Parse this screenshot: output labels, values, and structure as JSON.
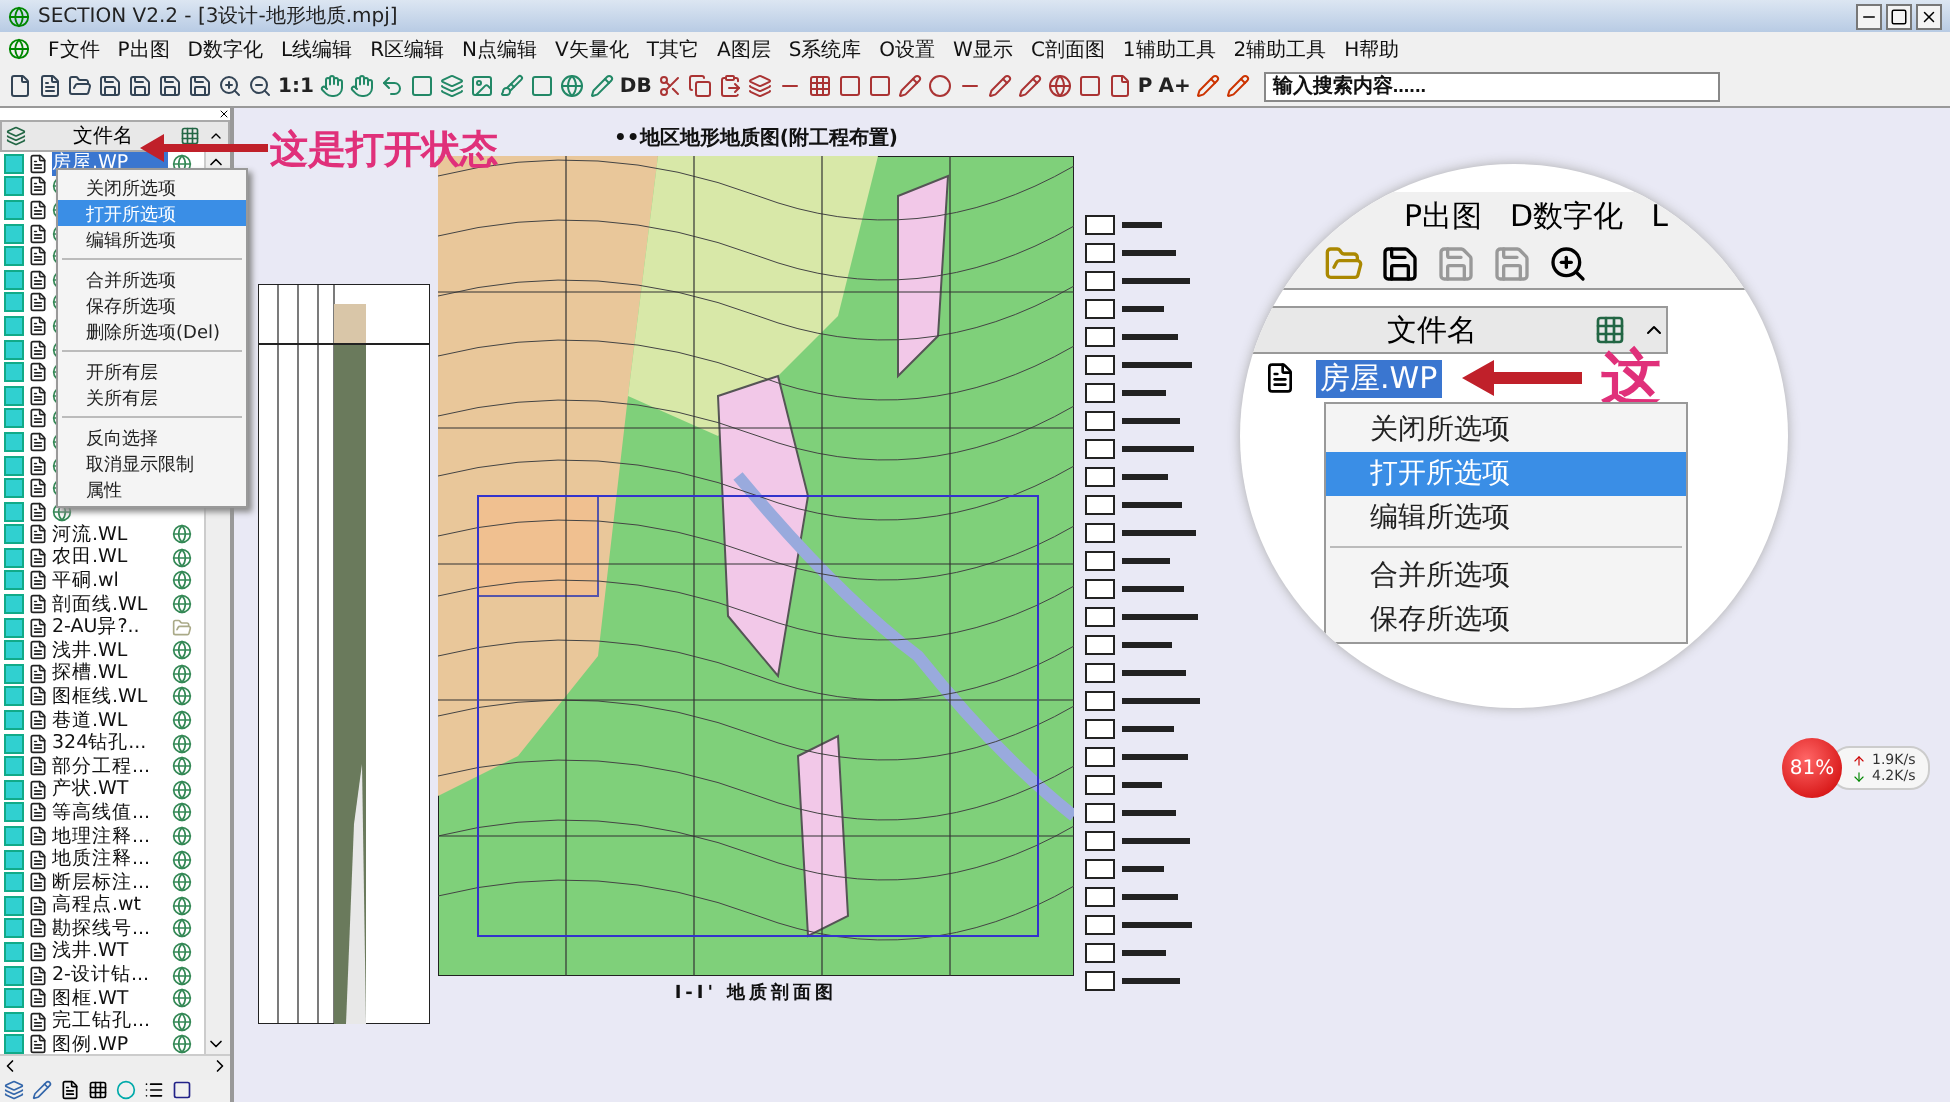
{
  "window": {
    "title": "SECTION V2.2 - [3设计-地形地质.mpj]"
  },
  "menu": [
    "F文件",
    "P出图",
    "D数字化",
    "L线编辑",
    "R区编辑",
    "N点编辑",
    "V矢量化",
    "T其它",
    "A图层",
    "S系统库",
    "O设置",
    "W显示",
    "C剖面图",
    "1辅助工具",
    "2辅助工具",
    "H帮助"
  ],
  "toolbar": {
    "labels": [
      "1:1",
      "DB",
      "P",
      "A+"
    ],
    "search": {
      "placeholder": "输入搜索内容......"
    }
  },
  "file_panel": {
    "column": "文件名",
    "files": [
      {
        "name": "房屋.WP",
        "selected": true,
        "kind": "layer"
      },
      {
        "kind": "layer"
      },
      {
        "kind": "layer"
      },
      {
        "kind": "layer"
      },
      {
        "kind": "layer"
      },
      {
        "kind": "layer"
      },
      {
        "kind": "layer"
      },
      {
        "kind": "layer"
      },
      {
        "kind": "layer"
      },
      {
        "kind": "layer"
      },
      {
        "kind": "layer"
      },
      {
        "kind": "layer"
      },
      {
        "kind": "layer"
      },
      {
        "kind": "layer"
      },
      {
        "kind": "layer"
      },
      {
        "kind": "layer"
      },
      {
        "name": "河流.WL",
        "selected": false,
        "kind": "layer"
      },
      {
        "name": "农田.WL",
        "selected": false,
        "kind": "layer"
      },
      {
        "name": "平硐.wl",
        "selected": false,
        "kind": "layer"
      },
      {
        "name": "剖面线.WL",
        "selected": false,
        "kind": "layer"
      },
      {
        "name": "2-AU异?..",
        "selected": false,
        "kind": "raster"
      },
      {
        "name": "浅井.WL",
        "selected": false,
        "kind": "layer"
      },
      {
        "name": "探槽.WL",
        "selected": false,
        "kind": "layer"
      },
      {
        "name": "图框线.WL",
        "selected": false,
        "kind": "layer"
      },
      {
        "name": "巷道.WL",
        "selected": false,
        "kind": "layer"
      },
      {
        "name": "324钻孔...",
        "selected": false,
        "kind": "layer"
      },
      {
        "name": "部分工程...",
        "selected": false,
        "kind": "layer"
      },
      {
        "name": "产状.WT",
        "selected": false,
        "kind": "layer"
      },
      {
        "name": "等高线值...",
        "selected": false,
        "kind": "layer"
      },
      {
        "name": "地理注释...",
        "selected": false,
        "kind": "layer"
      },
      {
        "name": "地质注释...",
        "selected": false,
        "kind": "layer"
      },
      {
        "name": "断层标注...",
        "selected": false,
        "kind": "layer"
      },
      {
        "name": "高程点.wt",
        "selected": false,
        "kind": "layer"
      },
      {
        "name": "勘探线号...",
        "selected": false,
        "kind": "layer"
      },
      {
        "name": "浅井.WT",
        "selected": false,
        "kind": "layer"
      },
      {
        "name": "2-设计钻...",
        "selected": false,
        "kind": "layer"
      },
      {
        "name": "图框.WT",
        "selected": false,
        "kind": "layer"
      },
      {
        "name": "完工钻孔...",
        "selected": false,
        "kind": "layer"
      },
      {
        "name": "图例.WP",
        "selected": false,
        "kind": "layer"
      }
    ]
  },
  "context_menu": [
    [
      {
        "label": "关闭所选项",
        "selected": false
      },
      {
        "label": "打开所选项",
        "selected": true
      },
      {
        "label": "编辑所选项",
        "selected": false
      }
    ],
    [
      {
        "label": "合并所选项",
        "selected": false
      },
      {
        "label": "保存所选项",
        "selected": false
      },
      {
        "label": "删除所选项(Del)",
        "selected": false
      }
    ],
    [
      {
        "label": "开所有层",
        "selected": false
      },
      {
        "label": "关所有层",
        "selected": false
      }
    ],
    [
      {
        "label": "反向选择",
        "selected": false
      },
      {
        "label": "取消显示限制",
        "selected": false
      },
      {
        "label": "属性",
        "selected": false
      }
    ]
  ],
  "annotation": "这是打开状态",
  "map": {
    "title": "••地区地形地质图(附工程布置)",
    "section_title": "I-I' 地质剖面图"
  },
  "magnifier": {
    "menu": [
      "P出图",
      "D数字化",
      "L"
    ],
    "column": "文件名",
    "file": "房屋.WP",
    "annotation": "这",
    "items": [
      {
        "label": "关闭所选项",
        "selected": false
      },
      {
        "label": "打开所选项",
        "selected": true
      },
      {
        "label": "编辑所选项",
        "selected": false
      },
      {
        "label": "合并所选项",
        "selected": false
      },
      {
        "label": "保存所选项",
        "selected": false
      }
    ]
  },
  "network_badge": {
    "percent": "81%",
    "up": "1.9K/s",
    "down": "4.2K/s"
  }
}
